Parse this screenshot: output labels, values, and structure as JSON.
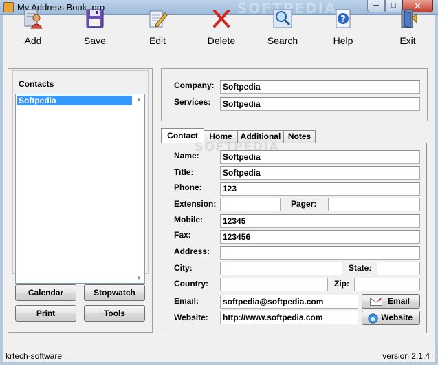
{
  "window": {
    "title": "My Address Book_pro",
    "watermark": "SOFTPEDIA"
  },
  "toolbar": {
    "add": "Add",
    "save": "Save",
    "edit": "Edit",
    "delete": "Delete",
    "search": "Search",
    "help": "Help",
    "exit": "Exit"
  },
  "contacts": {
    "title": "Contacts",
    "items": [
      "Softpedia"
    ]
  },
  "left_buttons": {
    "calendar": "Calendar",
    "stopwatch": "Stopwatch",
    "print": "Print",
    "tools": "Tools"
  },
  "company_box": {
    "company_label": "Company:",
    "company_value": "Softpedia",
    "services_label": "Services:",
    "services_value": "Softpedia"
  },
  "tabs": [
    "Contact",
    "Home",
    "Additional",
    "Notes"
  ],
  "tab_watermark": "SOFTPEDIA",
  "contact_form": {
    "name_label": "Name:",
    "name_value": "Softpedia",
    "title_label": "Title:",
    "title_value": "Softpedia",
    "phone_label": "Phone:",
    "phone_value": "123",
    "extension_label": "Extension:",
    "extension_value": "",
    "pager_label": "Pager:",
    "pager_value": "",
    "mobile_label": "Mobile:",
    "mobile_value": "12345",
    "fax_label": "Fax:",
    "fax_value": "123456",
    "address_label": "Address:",
    "address_value": "",
    "city_label": "City:",
    "city_value": "",
    "state_label": "State:",
    "state_value": "",
    "country_label": "Country:",
    "country_value": "",
    "zip_label": "Zip:",
    "zip_value": "",
    "email_label": "Email:",
    "email_value": "softpedia@softpedia.com",
    "email_button": "Email",
    "website_label": "Website:",
    "website_value": "http://www.softpedia.com",
    "website_button": "Website"
  },
  "status": {
    "left": "krtech-software",
    "right": "version 2.1.4"
  },
  "icons": [
    "app-icon",
    "add-contact-icon",
    "save-icon",
    "edit-icon",
    "delete-icon",
    "search-icon",
    "help-icon",
    "exit-icon",
    "email-icon",
    "website-icon"
  ]
}
